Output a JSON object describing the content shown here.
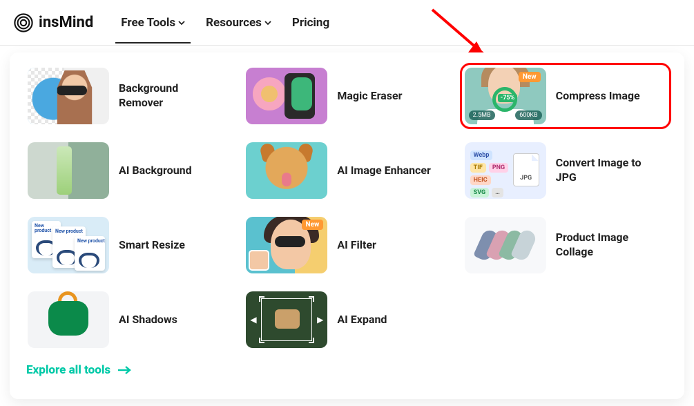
{
  "brand": "insMind",
  "nav": {
    "free_tools": "Free Tools",
    "resources": "Resources",
    "pricing": "Pricing"
  },
  "tools": {
    "bg_remover": "Background Remover",
    "magic_eraser": "Magic Eraser",
    "compress": "Compress Image",
    "ai_background": "AI Background",
    "ai_enhancer": "AI Image Enhancer",
    "convert_jpg": "Convert Image to JPG",
    "smart_resize": "Smart Resize",
    "ai_filter": "AI Filter",
    "product_collage": "Product Image Collage",
    "ai_shadows": "AI Shadows",
    "ai_expand": "AI Expand"
  },
  "compress_meta": {
    "badge": "New",
    "before": "2.5MB",
    "after": "600KB",
    "reduction": "-75%"
  },
  "filter_meta": {
    "badge": "New"
  },
  "convert_tags": {
    "webp": "Webp",
    "tif": "TIF",
    "png": "PNG",
    "heic": "HEIC",
    "svg": "SVG",
    "dots": "…",
    "target": "JPG"
  },
  "resize_card_label": "New product",
  "explore": "Explore all tools",
  "highlighted_tool": "compress"
}
